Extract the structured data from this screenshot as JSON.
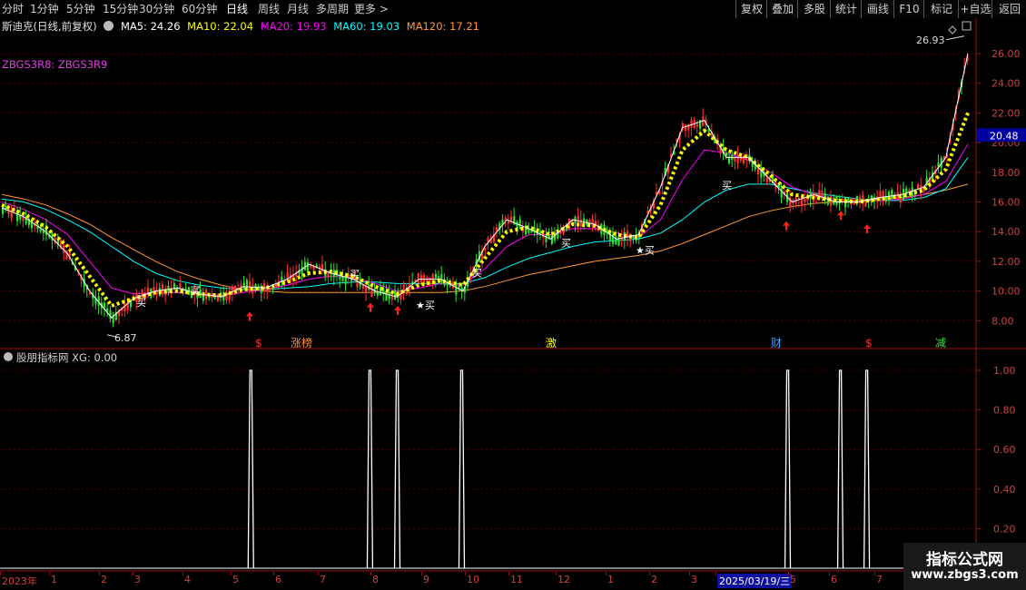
{
  "toolbar": {
    "left_items": [
      "分时",
      "1分钟",
      "5分钟",
      "15分钟",
      "30分钟",
      "60分钟",
      "日线",
      "周线",
      "月线",
      "多周期",
      "更多 >"
    ],
    "active": "日线",
    "right_items": [
      "复权",
      "叠加",
      "多股",
      "统计",
      "画线",
      "F10",
      "标记",
      "+自选",
      "返回"
    ]
  },
  "legend": {
    "stock": "斯迪克(日线,前复权)",
    "ma5": "MA5: 24.26",
    "ma10": "MA10: 22.04",
    "ma20": "MA20: 19.93",
    "ma60": "MA60: 19.03",
    "ma120": "MA120: 17.21",
    "colors": {
      "ma5": "#ffffff",
      "ma10": "#ffff00",
      "ma20": "#ff00ff",
      "ma60": "#00ffff",
      "ma120": "#ff9933"
    }
  },
  "indicator_label": "ZBGS3R8: ZBGS3R9",
  "sub_panel": {
    "label": "股朋指标网 XG: 0.00"
  },
  "annotations": {
    "high": "26.93",
    "low": "6.87",
    "current_price": "20.48",
    "buy": "买",
    "buy_star": "★买",
    "event_labels": [
      "$",
      "涨榜",
      "激",
      "财",
      "$",
      "减"
    ]
  },
  "chart_data": [
    {
      "type": "line",
      "title": "",
      "y_ticks": [
        "26.00",
        "24.00",
        "22.00",
        "20.00",
        "18.00",
        "16.00",
        "14.00",
        "12.00",
        "10.00",
        "8.00"
      ],
      "ylim": [
        6,
        28
      ],
      "x_labels": [
        "2023年",
        "1",
        "2",
        "3",
        "4",
        "5",
        "6",
        "7",
        "8",
        "9",
        "10",
        "11",
        "12",
        "1",
        "2",
        "3",
        "2025/03/19/三",
        "5",
        "6",
        "7"
      ],
      "series": [
        {
          "name": "MA5",
          "values": [
            15.6,
            15.0,
            14.0,
            12.5,
            10.0,
            8.2,
            9.5,
            10.0,
            10.2,
            9.8,
            9.6,
            10.3,
            10.2,
            10.8,
            11.8,
            11.2,
            10.8,
            10.0,
            9.6,
            10.8,
            10.8,
            10.0,
            13.0,
            14.8,
            14.2,
            13.5,
            14.8,
            14.5,
            13.5,
            13.8,
            17.0,
            21.0,
            21.5,
            19.0,
            19.0,
            17.5,
            16.0,
            16.5,
            16.0,
            16.0,
            16.3,
            16.5,
            17.0,
            19.0,
            26.0
          ]
        },
        {
          "name": "MA10",
          "values": [
            15.8,
            15.2,
            14.3,
            13.0,
            11.0,
            9.0,
            9.5,
            9.9,
            10.0,
            9.8,
            9.7,
            10.1,
            10.2,
            10.6,
            11.2,
            11.3,
            11.0,
            10.3,
            9.8,
            10.4,
            10.7,
            10.4,
            12.2,
            14.0,
            14.3,
            13.8,
            14.5,
            14.4,
            13.8,
            13.6,
            15.8,
            19.5,
            20.8,
            19.5,
            19.0,
            17.8,
            16.5,
            16.3,
            16.1,
            16.0,
            16.2,
            16.4,
            16.8,
            18.2,
            22.0
          ]
        },
        {
          "name": "MA20",
          "values": [
            16.0,
            15.5,
            14.8,
            13.8,
            12.0,
            10.2,
            9.8,
            9.9,
            9.9,
            9.8,
            9.7,
            9.9,
            10.1,
            10.4,
            10.8,
            11.0,
            10.9,
            10.5,
            10.0,
            10.2,
            10.5,
            10.4,
            11.5,
            13.0,
            13.8,
            13.8,
            14.2,
            14.2,
            13.9,
            13.6,
            14.8,
            17.5,
            19.5,
            19.3,
            18.8,
            18.0,
            17.0,
            16.5,
            16.2,
            16.1,
            16.1,
            16.2,
            16.5,
            17.4,
            19.9
          ]
        },
        {
          "name": "MA60",
          "values": [
            16.2,
            16.0,
            15.5,
            14.8,
            14.0,
            13.0,
            12.0,
            11.2,
            10.7,
            10.4,
            10.2,
            10.1,
            10.1,
            10.2,
            10.3,
            10.5,
            10.6,
            10.6,
            10.5,
            10.5,
            10.5,
            10.5,
            10.9,
            11.6,
            12.2,
            12.6,
            13.0,
            13.3,
            13.4,
            13.5,
            13.9,
            14.8,
            16.0,
            16.8,
            17.2,
            17.2,
            16.9,
            16.6,
            16.4,
            16.2,
            16.1,
            16.1,
            16.3,
            16.9,
            19.0
          ]
        },
        {
          "name": "MA120",
          "values": [
            16.5,
            16.2,
            15.8,
            15.2,
            14.5,
            13.6,
            12.8,
            12.0,
            11.3,
            10.8,
            10.4,
            10.1,
            10.0,
            9.9,
            9.9,
            9.9,
            9.9,
            9.9,
            9.9,
            9.9,
            9.9,
            10.0,
            10.3,
            10.7,
            11.1,
            11.4,
            11.7,
            12.0,
            12.2,
            12.4,
            12.7,
            13.2,
            13.8,
            14.4,
            15.0,
            15.4,
            15.7,
            15.9,
            16.0,
            16.1,
            16.2,
            16.3,
            16.5,
            16.8,
            17.2
          ]
        }
      ]
    },
    {
      "type": "bar",
      "title": "",
      "y_ticks": [
        "1.00",
        "0.80",
        "0.60",
        "0.40",
        "0.20"
      ],
      "ylim": [
        0,
        1.05
      ],
      "series": [
        {
          "name": "XG",
          "values": [
            0,
            0,
            0,
            0,
            0,
            0,
            0,
            0,
            0,
            0,
            0,
            0,
            0,
            0,
            0,
            0,
            0,
            0,
            0,
            0,
            0,
            0,
            0,
            0,
            0,
            0,
            0,
            0,
            0,
            0,
            0,
            0,
            0,
            0,
            0,
            0,
            0,
            0,
            0,
            0,
            0,
            0,
            0,
            0,
            0
          ]
        }
      ],
      "signals_x_fraction": [
        0.257,
        0.379,
        0.407,
        0.473,
        0.807,
        0.861,
        0.888
      ]
    }
  ]
}
